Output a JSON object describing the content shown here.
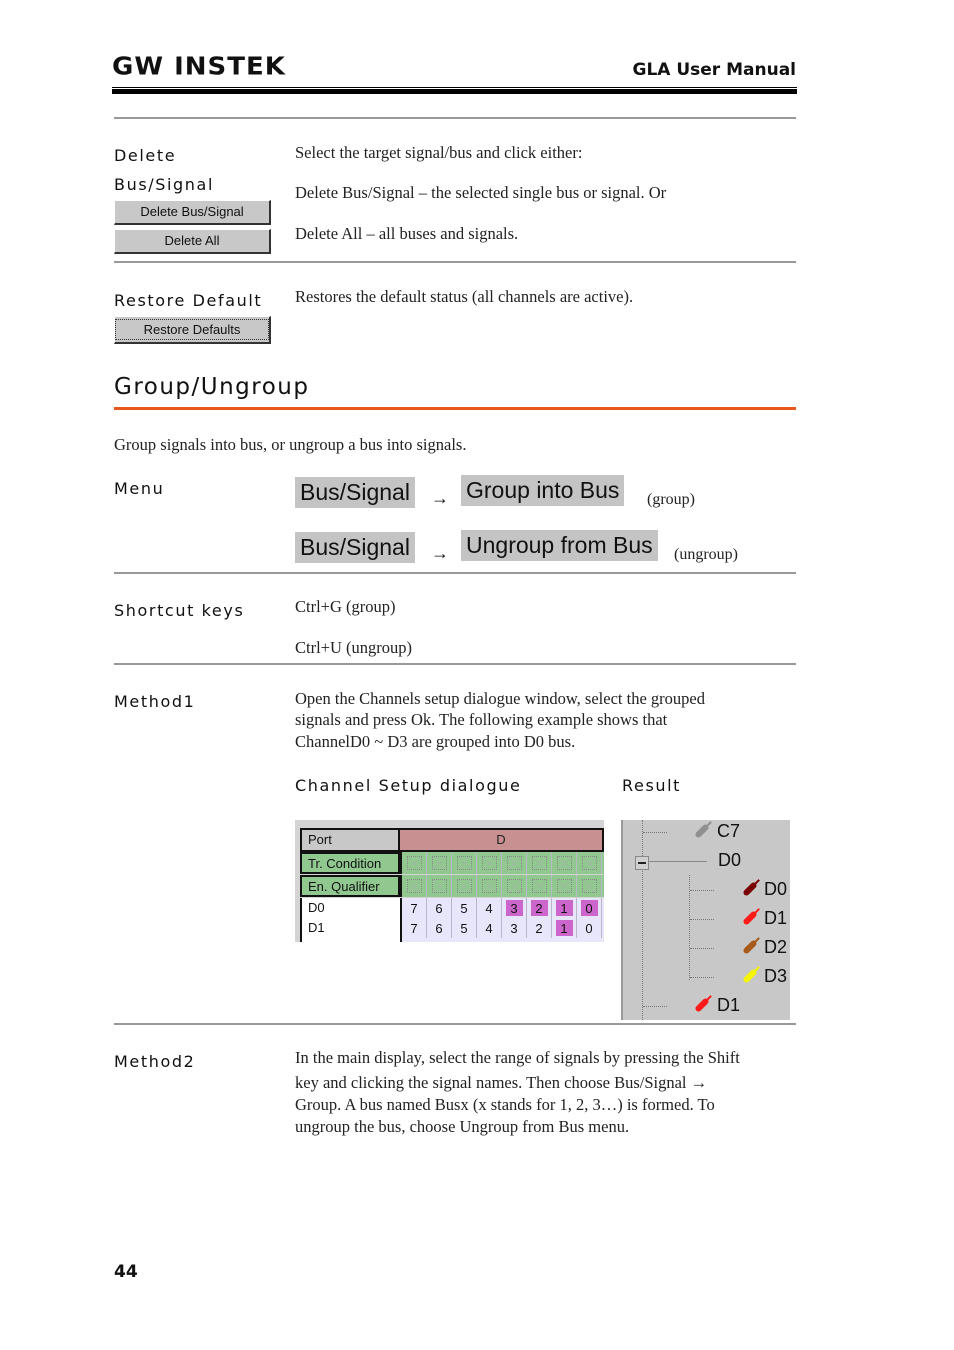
{
  "header": {
    "logo": "GW INSTEK",
    "manual_title": "GLA User Manual"
  },
  "delete_section": {
    "label_line1": "Delete",
    "label_line2": "Bus/Signal",
    "button_delete_bus_signal": "Delete Bus/Signal",
    "button_delete_all": "Delete All",
    "text_intro": "Select the target signal/bus and click either:",
    "text_bus_signal": "Delete Bus/Signal – the selected single bus or signal. Or",
    "text_all": "Delete All – all buses and signals."
  },
  "restore_section": {
    "label": "Restore Default",
    "button": "Restore Defaults",
    "text": "Restores the default status (all channels are active)."
  },
  "group_section": {
    "title": "Group/Ungroup",
    "intro": "Group signals into bus, or ungroup a bus into signals.",
    "menu_label": "Menu",
    "menu_rows": [
      {
        "from": "Bus/Signal",
        "arrow": "→",
        "to": "Group into Bus",
        "note": "(group)"
      },
      {
        "from": "Bus/Signal",
        "arrow": "→",
        "to": "Ungroup from Bus",
        "note": "(ungroup)"
      }
    ],
    "shortcut_label": "Shortcut keys",
    "shortcuts": [
      "Ctrl+G (group)",
      "Ctrl+U (ungroup)"
    ],
    "method1_label": "Method1",
    "method1_lines": [
      "Open the Channels setup dialogue window, select the grouped",
      "signals and press Ok. The following example shows that",
      "ChannelD0 ~ D3 are grouped into D0 bus."
    ],
    "channel_setup_caption": "Channel Setup dialogue",
    "result_caption": "Result",
    "method2_label": "Method2",
    "method2_lines": [
      "In the main display, select the range of  signals by pressing the Shift",
      "key and clicking the signal names. Then choose Bus/Signal  →",
      "Group. A bus named Busx (x stands for 1, 2, 3…) is formed. To",
      "ungroup the bus, choose Ungroup from Bus menu."
    ]
  },
  "channel_setup": {
    "port_label": "Port",
    "port_value": "D",
    "tr_condition_label": "Tr. Condition",
    "en_qualifier_label": "En. Qualifier",
    "rows": [
      {
        "name": "D0",
        "bits": [
          "7",
          "6",
          "5",
          "4",
          "3",
          "2",
          "1",
          "0"
        ],
        "selected": [
          false,
          false,
          false,
          false,
          true,
          true,
          true,
          true
        ]
      },
      {
        "name": "D1",
        "bits": [
          "7",
          "6",
          "5",
          "4",
          "3",
          "2",
          "1",
          "0"
        ],
        "selected": [
          false,
          false,
          false,
          false,
          false,
          false,
          true,
          false
        ]
      }
    ],
    "colors": {
      "port": "#c89090",
      "green": "#90c890",
      "selected": "#cc66cc",
      "lavender": "#e8e6fa"
    }
  },
  "result_tree": {
    "items": [
      {
        "label": "C7",
        "level": 0,
        "probe_color": "#909090"
      },
      {
        "label": "D0",
        "level": 0,
        "collapsible": true
      },
      {
        "label": "D0",
        "level": 1,
        "probe_color": "#7a0000"
      },
      {
        "label": "D1",
        "level": 1,
        "probe_color": "#ff1a1a"
      },
      {
        "label": "D2",
        "level": 1,
        "probe_color": "#a85a1a"
      },
      {
        "label": "D3",
        "level": 1,
        "probe_color": "#f5f500"
      },
      {
        "label": "D1",
        "level": 0,
        "probe_color": "#ff1a1a"
      }
    ]
  },
  "footer": {
    "page_number": "44"
  },
  "colors": {
    "accent_rule": "#e8581c",
    "divider": "#999999"
  }
}
